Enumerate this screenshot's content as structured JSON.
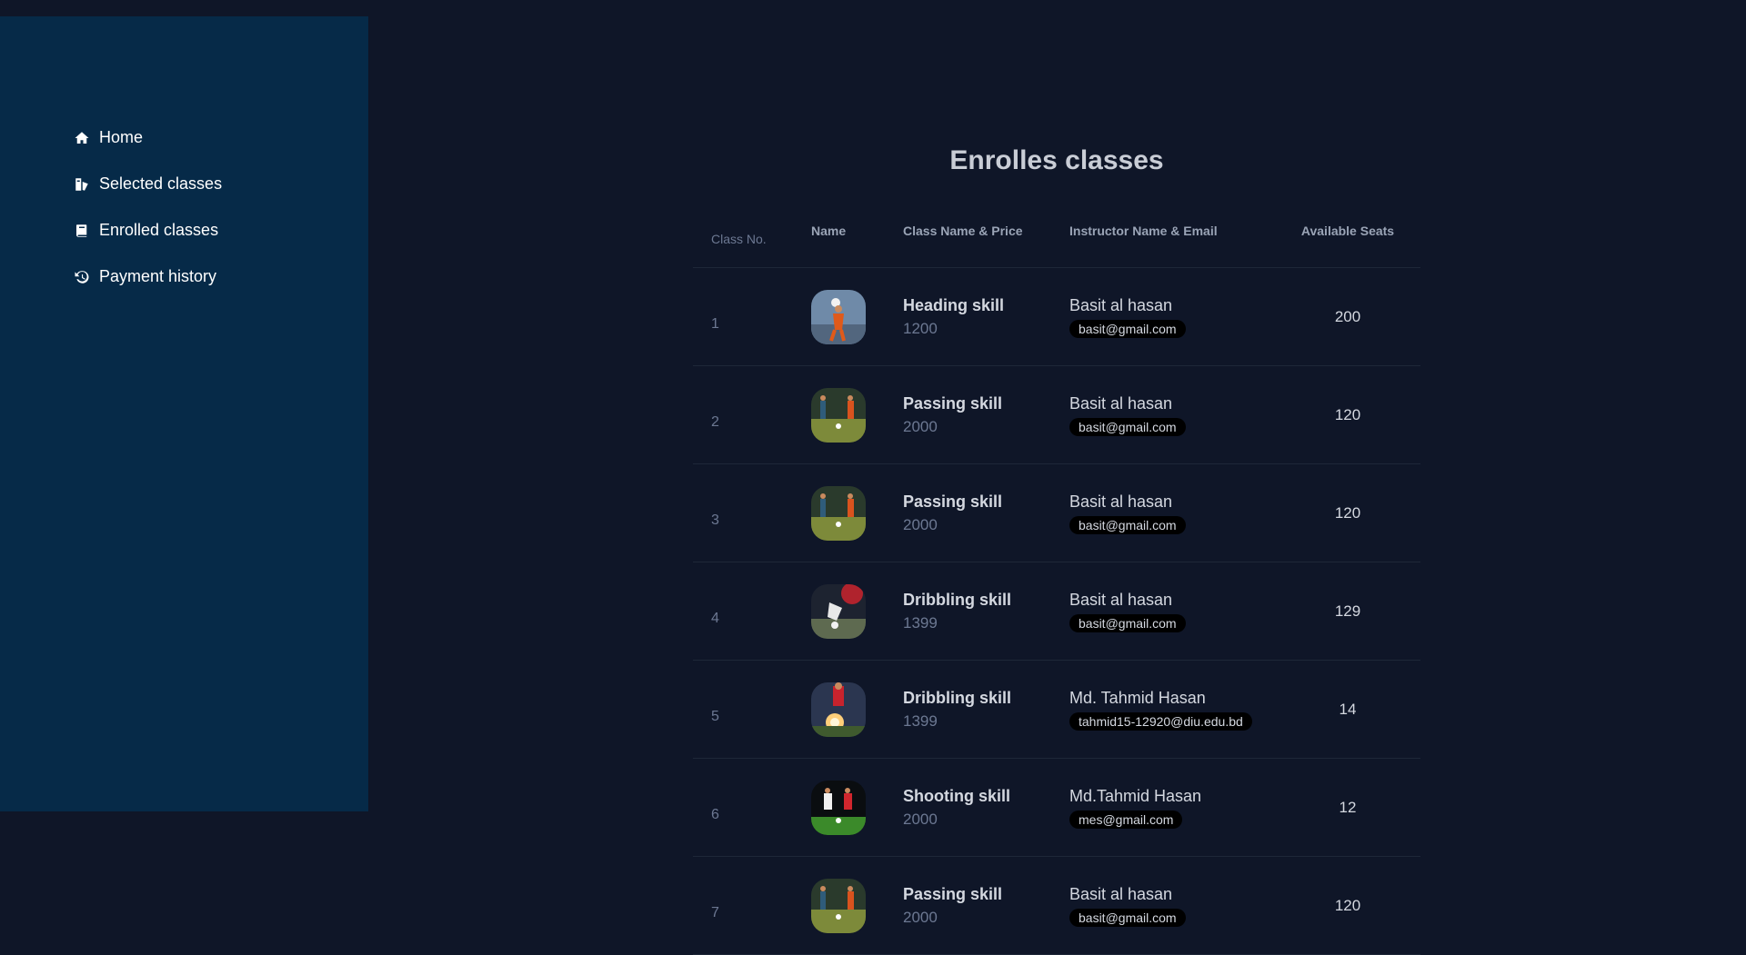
{
  "sidebar": {
    "items": [
      {
        "label": "Home",
        "icon": "home-icon"
      },
      {
        "label": "Selected classes",
        "icon": "selected-classes-icon"
      },
      {
        "label": "Enrolled classes",
        "icon": "book-icon"
      },
      {
        "label": "Payment history",
        "icon": "history-icon"
      }
    ]
  },
  "main": {
    "title": "Enrolles classes",
    "columns": [
      "Class No.",
      "Name",
      "Class Name & Price",
      "Instructor Name & Email",
      "Available Seats"
    ],
    "rows": [
      {
        "no": "1",
        "class_name": "Heading skill",
        "price": "1200",
        "instructor": "Basit al hasan",
        "email": "basit@gmail.com",
        "seats": "200",
        "image": "heading-skill-photo"
      },
      {
        "no": "2",
        "class_name": "Passing skill",
        "price": "2000",
        "instructor": "Basit al hasan",
        "email": "basit@gmail.com",
        "seats": "120",
        "image": "passing-skill-photo"
      },
      {
        "no": "3",
        "class_name": "Passing skill",
        "price": "2000",
        "instructor": "Basit al hasan",
        "email": "basit@gmail.com",
        "seats": "120",
        "image": "passing-skill-photo"
      },
      {
        "no": "4",
        "class_name": "Dribbling skill",
        "price": "1399",
        "instructor": "Basit al hasan",
        "email": "basit@gmail.com",
        "seats": "129",
        "image": "dribbling-skill-photo"
      },
      {
        "no": "5",
        "class_name": "Dribbling skill",
        "price": "1399",
        "instructor": "Md. Tahmid Hasan",
        "email": "tahmid15-12920@diu.edu.bd",
        "seats": "14",
        "image": "dribbling-skill-photo-2"
      },
      {
        "no": "6",
        "class_name": "Shooting skill",
        "price": "2000",
        "instructor": "Md.Tahmid Hasan",
        "email": "mes@gmail.com",
        "seats": "12",
        "image": "shooting-skill-photo"
      },
      {
        "no": "7",
        "class_name": "Passing skill",
        "price": "2000",
        "instructor": "Basit al hasan",
        "email": "basit@gmail.com",
        "seats": "120",
        "image": "passing-skill-photo"
      }
    ]
  },
  "colors": {
    "background": "#0f1628",
    "sidebar": "#062a48",
    "email_badge": "#000000"
  }
}
